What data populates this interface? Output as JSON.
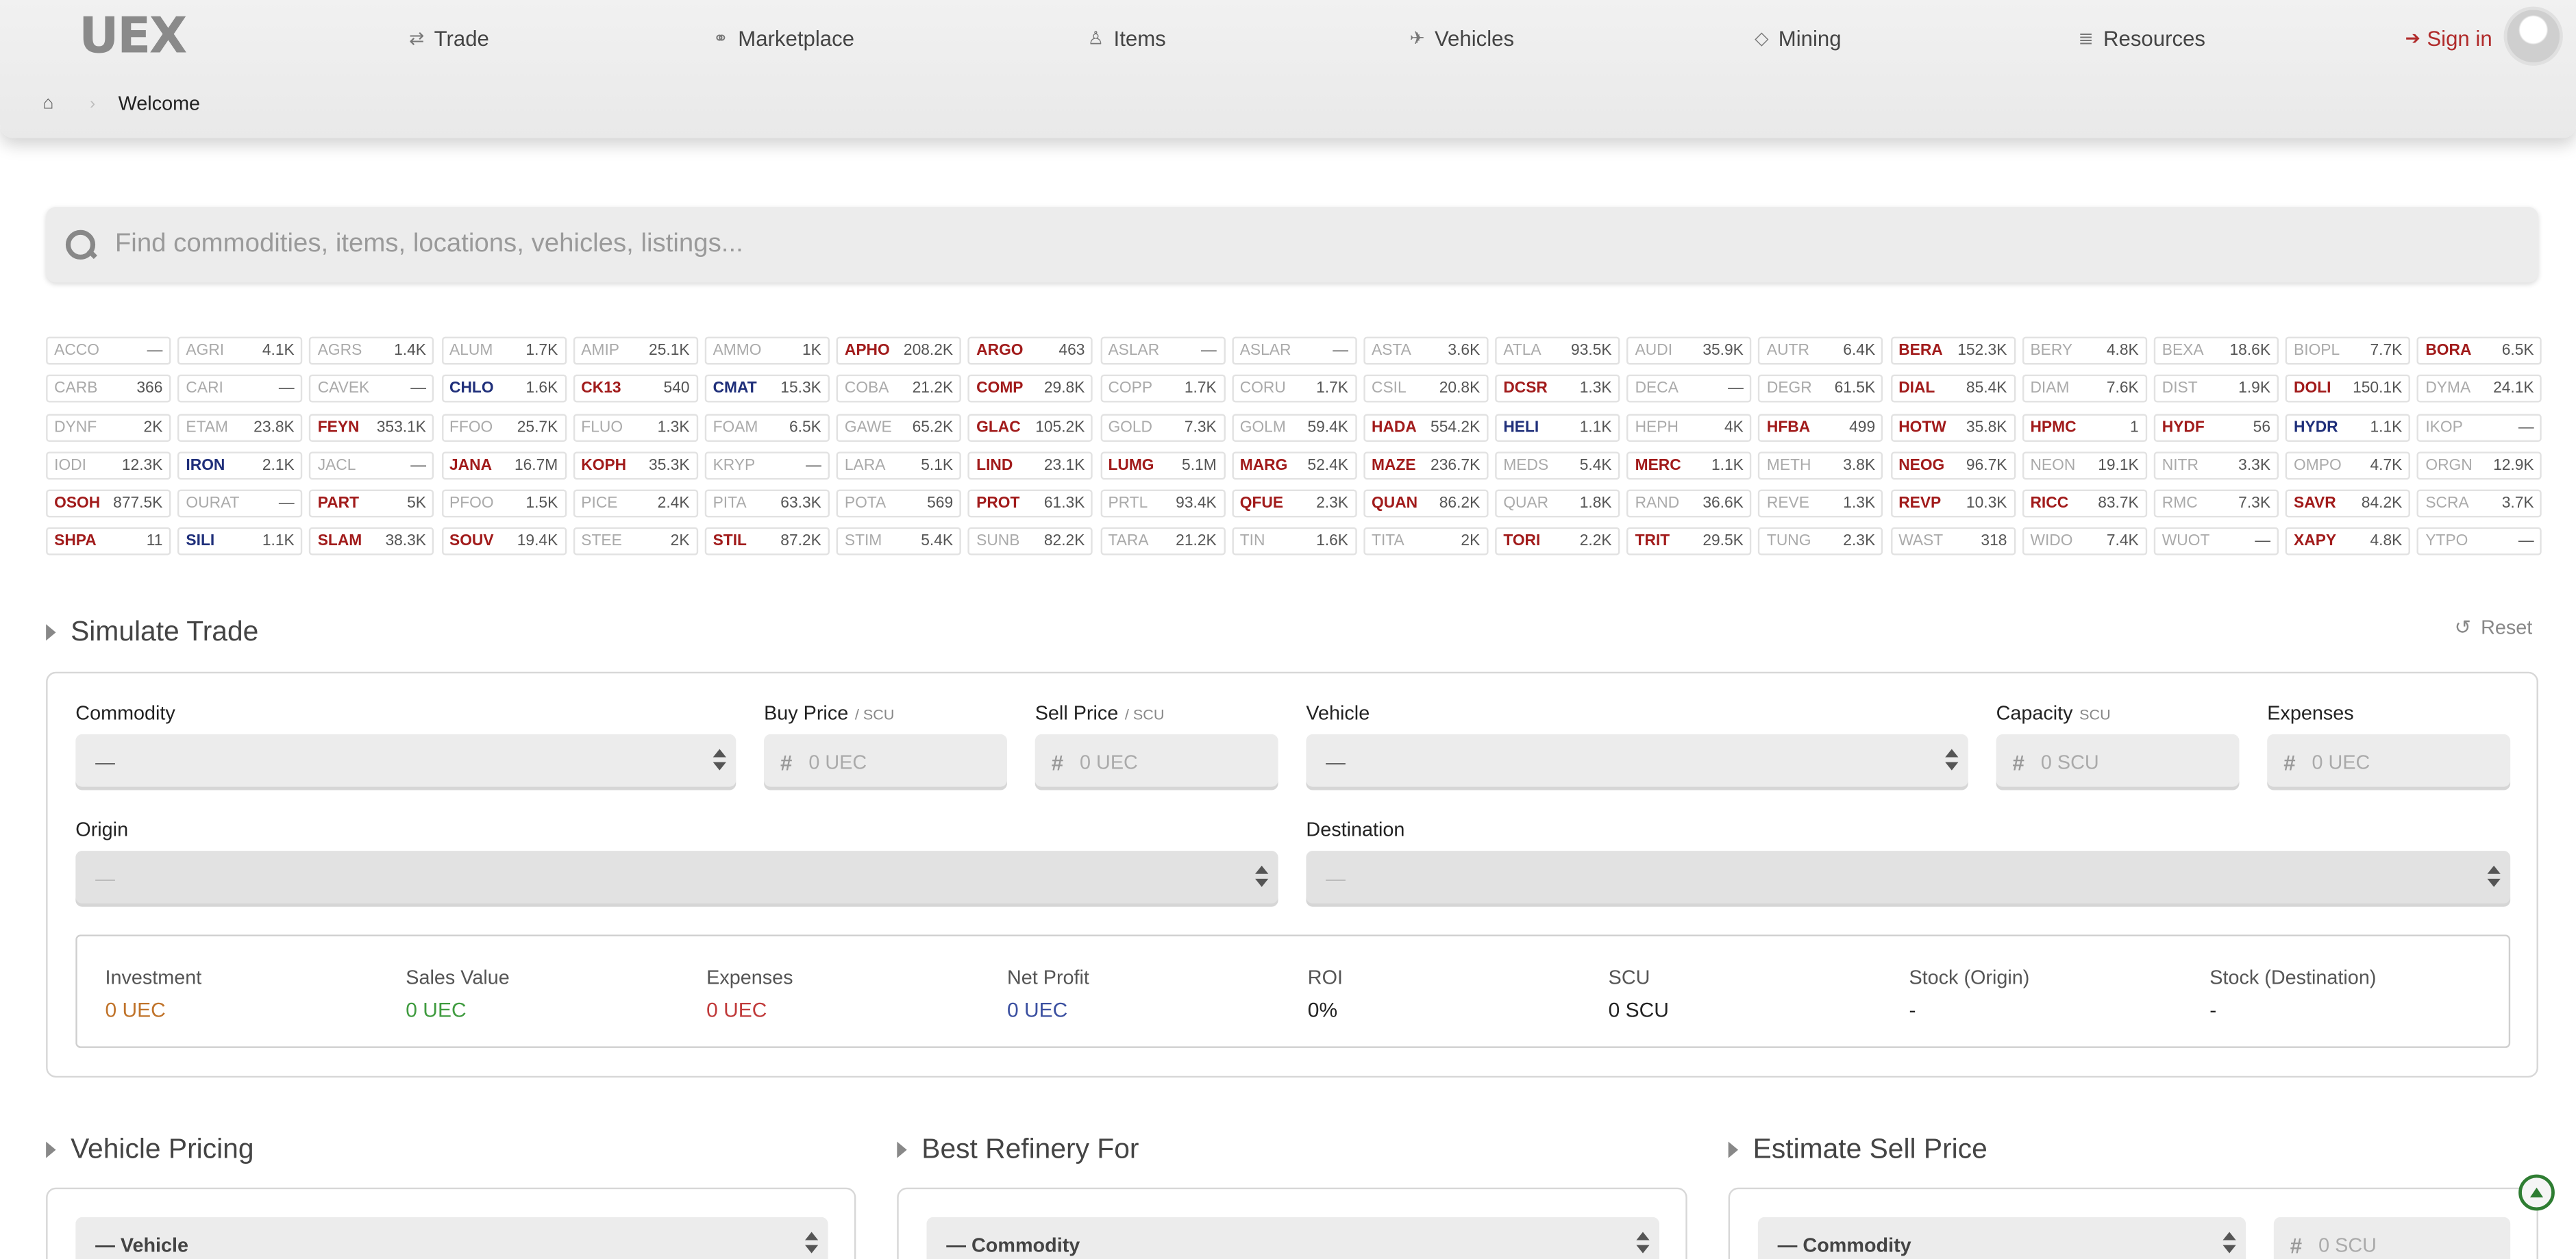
{
  "nav": {
    "logo": "UEX",
    "items": [
      {
        "label": "Trade",
        "icon": "exchange-icon"
      },
      {
        "label": "Marketplace",
        "icon": "handshake-icon"
      },
      {
        "label": "Items",
        "icon": "person-icon"
      },
      {
        "label": "Vehicles",
        "icon": "plane-icon"
      },
      {
        "label": "Mining",
        "icon": "gem-icon"
      },
      {
        "label": "Resources",
        "icon": "database-icon"
      }
    ],
    "signin": "Sign in"
  },
  "breadcrumb": {
    "current": "Welcome"
  },
  "search": {
    "placeholder": "Find commodities, items, locations, vehicles, listings..."
  },
  "ticker": [
    {
      "code": "ACCO",
      "value": "—",
      "style": "gray"
    },
    {
      "code": "AGRI",
      "value": "4.1K",
      "style": "gray"
    },
    {
      "code": "AGRS",
      "value": "1.4K",
      "style": "gray"
    },
    {
      "code": "ALUM",
      "value": "1.7K",
      "style": "gray"
    },
    {
      "code": "AMIP",
      "value": "25.1K",
      "style": "gray"
    },
    {
      "code": "AMMO",
      "value": "1K",
      "style": "gray"
    },
    {
      "code": "APHO",
      "value": "208.2K",
      "style": "red"
    },
    {
      "code": "ARGO",
      "value": "463",
      "style": "red"
    },
    {
      "code": "ASLAR",
      "value": "—",
      "style": "gray"
    },
    {
      "code": "ASLAR",
      "value": "—",
      "style": "gray"
    },
    {
      "code": "ASTA",
      "value": "3.6K",
      "style": "gray"
    },
    {
      "code": "ATLA",
      "value": "93.5K",
      "style": "gray"
    },
    {
      "code": "AUDI",
      "value": "35.9K",
      "style": "gray"
    },
    {
      "code": "AUTR",
      "value": "6.4K",
      "style": "gray"
    },
    {
      "code": "BERA",
      "value": "152.3K",
      "style": "red"
    },
    {
      "code": "BERY",
      "value": "4.8K",
      "style": "gray"
    },
    {
      "code": "BEXA",
      "value": "18.6K",
      "style": "gray"
    },
    {
      "code": "BIOPL",
      "value": "7.7K",
      "style": "gray"
    },
    {
      "code": "BORA",
      "value": "6.5K",
      "style": "red"
    },
    {
      "code": "CARB",
      "value": "366",
      "style": "gray"
    },
    {
      "code": "CARI",
      "value": "—",
      "style": "gray"
    },
    {
      "code": "CAVEK",
      "value": "—",
      "style": "gray"
    },
    {
      "code": "CHLO",
      "value": "1.6K",
      "style": "blue"
    },
    {
      "code": "CK13",
      "value": "540",
      "style": "red"
    },
    {
      "code": "CMAT",
      "value": "15.3K",
      "style": "blue"
    },
    {
      "code": "COBA",
      "value": "21.2K",
      "style": "gray"
    },
    {
      "code": "COMP",
      "value": "29.8K",
      "style": "red"
    },
    {
      "code": "COPP",
      "value": "1.7K",
      "style": "gray"
    },
    {
      "code": "CORU",
      "value": "1.7K",
      "style": "gray"
    },
    {
      "code": "CSIL",
      "value": "20.8K",
      "style": "gray"
    },
    {
      "code": "DCSR",
      "value": "1.3K",
      "style": "red"
    },
    {
      "code": "DECA",
      "value": "—",
      "style": "gray"
    },
    {
      "code": "DEGR",
      "value": "61.5K",
      "style": "gray"
    },
    {
      "code": "DIAL",
      "value": "85.4K",
      "style": "red"
    },
    {
      "code": "DIAM",
      "value": "7.6K",
      "style": "gray"
    },
    {
      "code": "DIST",
      "value": "1.9K",
      "style": "gray"
    },
    {
      "code": "DOLI",
      "value": "150.1K",
      "style": "red"
    },
    {
      "code": "DYMA",
      "value": "24.1K",
      "style": "gray"
    },
    {
      "code": "DYNF",
      "value": "2K",
      "style": "gray"
    },
    {
      "code": "ETAM",
      "value": "23.8K",
      "style": "gray"
    },
    {
      "code": "FEYN",
      "value": "353.1K",
      "style": "red"
    },
    {
      "code": "FFOO",
      "value": "25.7K",
      "style": "gray"
    },
    {
      "code": "FLUO",
      "value": "1.3K",
      "style": "gray"
    },
    {
      "code": "FOAM",
      "value": "6.5K",
      "style": "gray"
    },
    {
      "code": "GAWE",
      "value": "65.2K",
      "style": "gray"
    },
    {
      "code": "GLAC",
      "value": "105.2K",
      "style": "red"
    },
    {
      "code": "GOLD",
      "value": "7.3K",
      "style": "gray"
    },
    {
      "code": "GOLM",
      "value": "59.4K",
      "style": "gray"
    },
    {
      "code": "HADA",
      "value": "554.2K",
      "style": "red"
    },
    {
      "code": "HELI",
      "value": "1.1K",
      "style": "blue"
    },
    {
      "code": "HEPH",
      "value": "4K",
      "style": "gray"
    },
    {
      "code": "HFBA",
      "value": "499",
      "style": "red"
    },
    {
      "code": "HOTW",
      "value": "35.8K",
      "style": "red"
    },
    {
      "code": "HPMC",
      "value": "1",
      "style": "red"
    },
    {
      "code": "HYDF",
      "value": "56",
      "style": "red"
    },
    {
      "code": "HYDR",
      "value": "1.1K",
      "style": "blue"
    },
    {
      "code": "IKOP",
      "value": "—",
      "style": "gray"
    },
    {
      "code": "IODI",
      "value": "12.3K",
      "style": "gray"
    },
    {
      "code": "IRON",
      "value": "2.1K",
      "style": "blue"
    },
    {
      "code": "JACL",
      "value": "—",
      "style": "gray"
    },
    {
      "code": "JANA",
      "value": "16.7M",
      "style": "red"
    },
    {
      "code": "KOPH",
      "value": "35.3K",
      "style": "red"
    },
    {
      "code": "KRYP",
      "value": "—",
      "style": "gray"
    },
    {
      "code": "LARA",
      "value": "5.1K",
      "style": "gray"
    },
    {
      "code": "LIND",
      "value": "23.1K",
      "style": "red"
    },
    {
      "code": "LUMG",
      "value": "5.1M",
      "style": "red"
    },
    {
      "code": "MARG",
      "value": "52.4K",
      "style": "red"
    },
    {
      "code": "MAZE",
      "value": "236.7K",
      "style": "red"
    },
    {
      "code": "MEDS",
      "value": "5.4K",
      "style": "gray"
    },
    {
      "code": "MERC",
      "value": "1.1K",
      "style": "red"
    },
    {
      "code": "METH",
      "value": "3.8K",
      "style": "gray"
    },
    {
      "code": "NEOG",
      "value": "96.7K",
      "style": "red"
    },
    {
      "code": "NEON",
      "value": "19.1K",
      "style": "gray"
    },
    {
      "code": "NITR",
      "value": "3.3K",
      "style": "gray"
    },
    {
      "code": "OMPO",
      "value": "4.7K",
      "style": "gray"
    },
    {
      "code": "ORGN",
      "value": "12.9K",
      "style": "gray"
    },
    {
      "code": "OSOH",
      "value": "877.5K",
      "style": "red"
    },
    {
      "code": "OURAT",
      "value": "—",
      "style": "gray"
    },
    {
      "code": "PART",
      "value": "5K",
      "style": "red"
    },
    {
      "code": "PFOO",
      "value": "1.5K",
      "style": "gray"
    },
    {
      "code": "PICE",
      "value": "2.4K",
      "style": "gray"
    },
    {
      "code": "PITA",
      "value": "63.3K",
      "style": "gray"
    },
    {
      "code": "POTA",
      "value": "569",
      "style": "gray"
    },
    {
      "code": "PROT",
      "value": "61.3K",
      "style": "red"
    },
    {
      "code": "PRTL",
      "value": "93.4K",
      "style": "gray"
    },
    {
      "code": "QFUE",
      "value": "2.3K",
      "style": "red"
    },
    {
      "code": "QUAN",
      "value": "86.2K",
      "style": "red"
    },
    {
      "code": "QUAR",
      "value": "1.8K",
      "style": "gray"
    },
    {
      "code": "RAND",
      "value": "36.6K",
      "style": "gray"
    },
    {
      "code": "REVE",
      "value": "1.3K",
      "style": "gray"
    },
    {
      "code": "REVP",
      "value": "10.3K",
      "style": "red"
    },
    {
      "code": "RICC",
      "value": "83.7K",
      "style": "red"
    },
    {
      "code": "RMC",
      "value": "7.3K",
      "style": "gray"
    },
    {
      "code": "SAVR",
      "value": "84.2K",
      "style": "red"
    },
    {
      "code": "SCRA",
      "value": "3.7K",
      "style": "gray"
    },
    {
      "code": "SHPA",
      "value": "11",
      "style": "red"
    },
    {
      "code": "SILI",
      "value": "1.1K",
      "style": "blue"
    },
    {
      "code": "SLAM",
      "value": "38.3K",
      "style": "red"
    },
    {
      "code": "SOUV",
      "value": "19.4K",
      "style": "red"
    },
    {
      "code": "STEE",
      "value": "2K",
      "style": "gray"
    },
    {
      "code": "STIL",
      "value": "87.2K",
      "style": "red"
    },
    {
      "code": "STIM",
      "value": "5.4K",
      "style": "gray"
    },
    {
      "code": "SUNB",
      "value": "82.2K",
      "style": "gray"
    },
    {
      "code": "TARA",
      "value": "21.2K",
      "style": "gray"
    },
    {
      "code": "TIN",
      "value": "1.6K",
      "style": "gray"
    },
    {
      "code": "TITA",
      "value": "2K",
      "style": "gray"
    },
    {
      "code": "TORI",
      "value": "2.2K",
      "style": "red"
    },
    {
      "code": "TRIT",
      "value": "29.5K",
      "style": "red"
    },
    {
      "code": "TUNG",
      "value": "2.3K",
      "style": "gray"
    },
    {
      "code": "WAST",
      "value": "318",
      "style": "gray"
    },
    {
      "code": "WIDO",
      "value": "7.4K",
      "style": "gray"
    },
    {
      "code": "WUOT",
      "value": "—",
      "style": "gray"
    },
    {
      "code": "XAPY",
      "value": "4.8K",
      "style": "red"
    },
    {
      "code": "YTPO",
      "value": "—",
      "style": "gray"
    }
  ],
  "simulate": {
    "title": "Simulate Trade",
    "reset": "Reset",
    "commodity_label": "Commodity",
    "commodity_value": "—",
    "buy_label": "Buy Price",
    "buy_unit": "/ SCU",
    "buy_placeholder": "0 UEC",
    "sell_label": "Sell Price",
    "sell_unit": "/ SCU",
    "sell_placeholder": "0 UEC",
    "vehicle_label": "Vehicle",
    "vehicle_value": "—",
    "capacity_label": "Capacity",
    "capacity_unit": "SCU",
    "capacity_placeholder": "0 SCU",
    "expenses_label": "Expenses",
    "expenses_placeholder": "0 UEC",
    "origin_label": "Origin",
    "origin_value": "—",
    "destination_label": "Destination",
    "destination_value": "—",
    "summary": [
      {
        "label": "Investment",
        "value": "0 UEC",
        "color": "#c0732a"
      },
      {
        "label": "Sales Value",
        "value": "0 UEC",
        "color": "#3f9b3f"
      },
      {
        "label": "Expenses",
        "value": "0 UEC",
        "color": "#c03a3a"
      },
      {
        "label": "Net Profit",
        "value": "0 UEC",
        "color": "#3a4fa0"
      },
      {
        "label": "ROI",
        "value": "0%",
        "color": "#222222"
      },
      {
        "label": "SCU",
        "value": "0 SCU",
        "color": "#222222"
      },
      {
        "label": "Stock (Origin)",
        "value": "-",
        "color": "#222222"
      },
      {
        "label": "Stock (Destination)",
        "value": "-",
        "color": "#222222"
      }
    ]
  },
  "vehicle_pricing": {
    "title": "Vehicle Pricing",
    "select": "— Vehicle"
  },
  "best_refinery": {
    "title": "Best Refinery For",
    "select": "— Commodity"
  },
  "estimate_sell": {
    "title": "Estimate Sell Price",
    "select": "— Commodity",
    "scu_placeholder": "0 SCU"
  },
  "colors": {
    "accent_red": "#a11b1b",
    "accent_blue": "#1f2f7a",
    "signin": "#b02a2a"
  }
}
